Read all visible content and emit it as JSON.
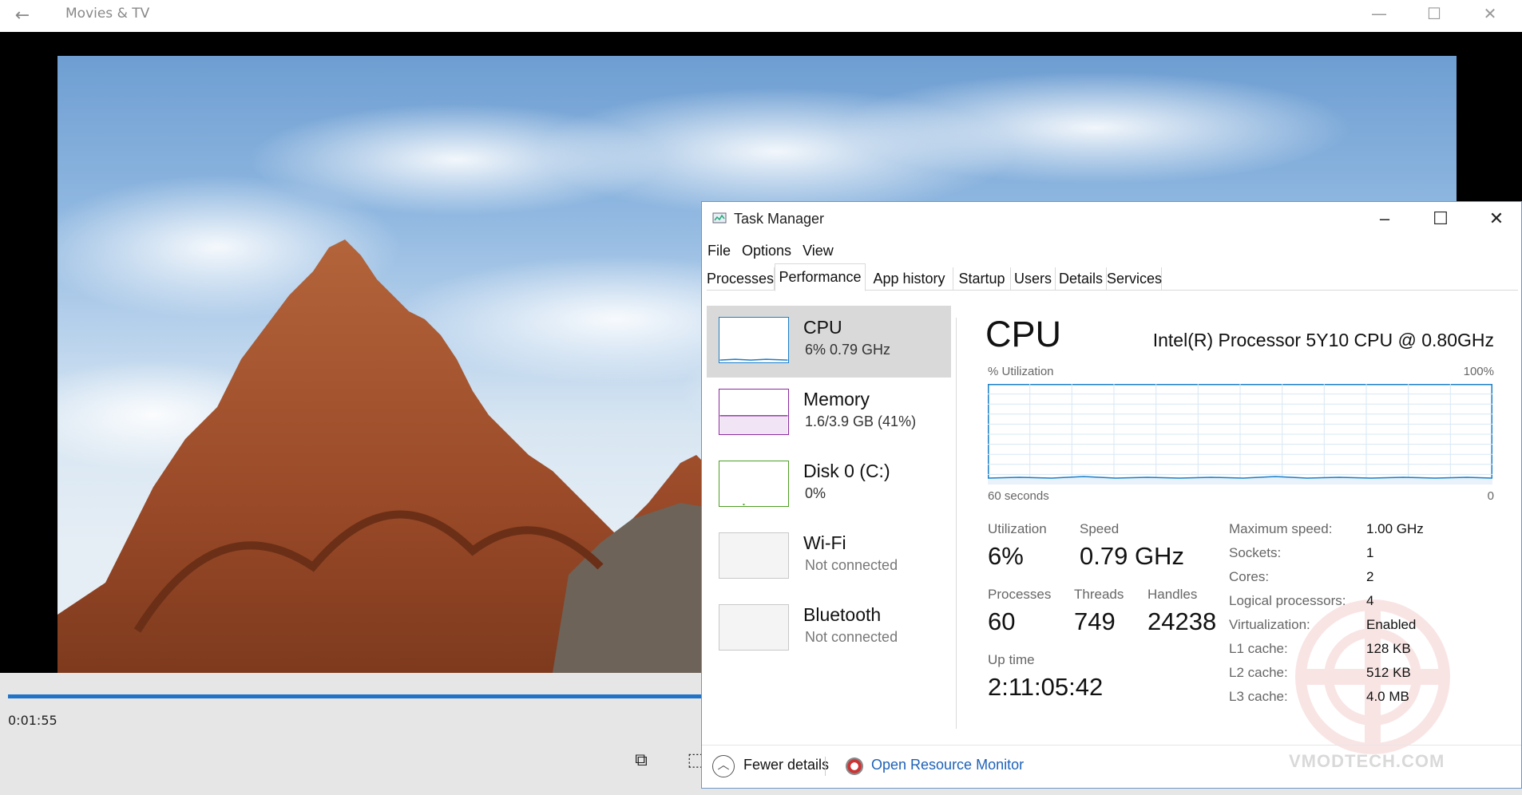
{
  "movies": {
    "title": "Movies & TV",
    "current_time": "0:01:55",
    "progress_fraction": 0.46
  },
  "task_manager": {
    "title": "Task Manager",
    "menu": [
      "File",
      "Options",
      "View"
    ],
    "tabs": [
      "Processes",
      "Performance",
      "App history",
      "Startup",
      "Users",
      "Details",
      "Services"
    ],
    "active_tab": "Performance",
    "sidebar": [
      {
        "title": "CPU",
        "sub": "6%  0.79 GHz",
        "color": "#1a7fc9"
      },
      {
        "title": "Memory",
        "sub": "1.6/3.9 GB (41%)",
        "color": "#8b2aa0"
      },
      {
        "title": "Disk 0 (C:)",
        "sub": "0%",
        "color": "#4ca023"
      },
      {
        "title": "Wi-Fi",
        "sub": "Not connected",
        "color": "#aaaaaa"
      },
      {
        "title": "Bluetooth",
        "sub": "Not connected",
        "color": "#aaaaaa"
      }
    ],
    "perf": {
      "title": "CPU",
      "model": "Intel(R) Processor 5Y10 CPU @ 0.80GHz",
      "util_label": "% Utilization",
      "util_max": "100%",
      "graph_time": "60 seconds",
      "graph_min": "0",
      "utilization_label": "Utilization",
      "utilization": "6%",
      "speed_label": "Speed",
      "speed": "0.79 GHz",
      "processes_label": "Processes",
      "processes": "60",
      "threads_label": "Threads",
      "threads": "749",
      "handles_label": "Handles",
      "handles": "24238",
      "uptime_label": "Up time",
      "uptime": "2:11:05:42",
      "info": [
        {
          "label": "Maximum speed:",
          "value": "1.00 GHz"
        },
        {
          "label": "Sockets:",
          "value": "1"
        },
        {
          "label": "Cores:",
          "value": "2"
        },
        {
          "label": "Logical processors:",
          "value": "4"
        },
        {
          "label": "Virtualization:",
          "value": "Enabled"
        },
        {
          "label": "L1 cache:",
          "value": "128 KB"
        },
        {
          "label": "L2 cache:",
          "value": "512 KB"
        },
        {
          "label": "L3 cache:",
          "value": "4.0 MB"
        }
      ]
    },
    "fewer_details": "Fewer details",
    "open_resource_monitor": "Open Resource Monitor",
    "watermark": "VMODTECH.COM"
  }
}
